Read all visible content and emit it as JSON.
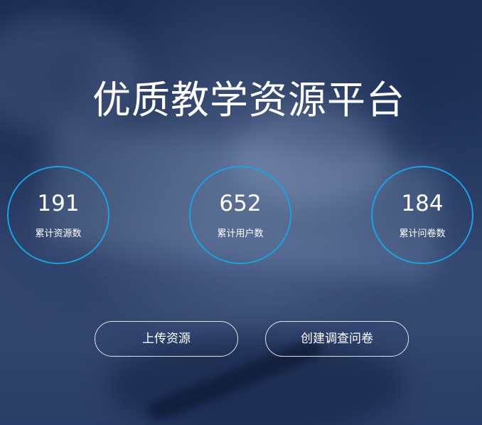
{
  "hero": {
    "title": "优质教学资源平台"
  },
  "stats": [
    {
      "value": "191",
      "label": "累计资源数"
    },
    {
      "value": "652",
      "label": "累计用户数"
    },
    {
      "value": "184",
      "label": "累计问卷数"
    }
  ],
  "actions": {
    "upload_label": "上传资源",
    "create_survey_label": "创建调查问卷"
  },
  "colors": {
    "circle_border": "#19a2e6",
    "background": "#2b3d66",
    "text": "#ffffff"
  }
}
